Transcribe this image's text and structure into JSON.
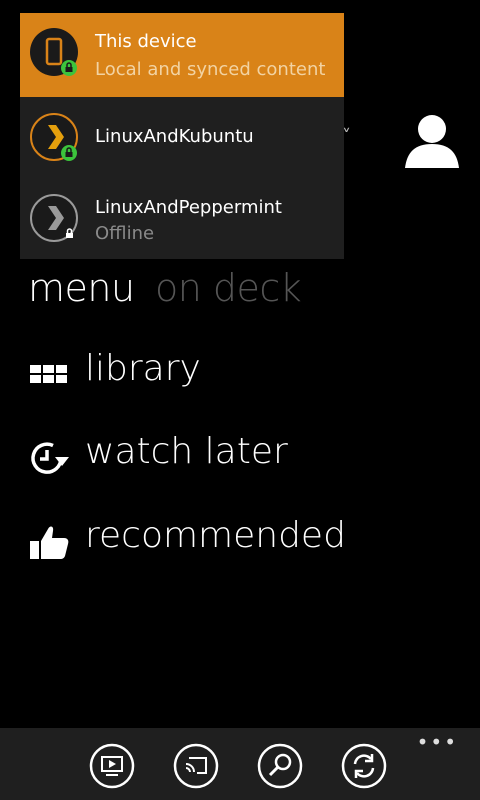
{
  "servers": [
    {
      "name": "This device",
      "subtitle": "Local and synced content",
      "icon": "phone-icon",
      "selected": true
    },
    {
      "name": "LinuxAndKubuntu",
      "subtitle": "",
      "icon": "plex-icon",
      "selected": false
    },
    {
      "name": "LinuxAndPeppermint",
      "subtitle": "Offline",
      "icon": "plex-icon",
      "selected": false
    }
  ],
  "pivots": {
    "active": "menu",
    "inactive": "on deck"
  },
  "menu": {
    "library": "library",
    "watch_later": "watch later",
    "recommended": "recommended"
  },
  "app_bar": {
    "more": "•••"
  },
  "header": {
    "chevron": "˅"
  },
  "colors": {
    "accent": "#d98318",
    "online": "#3cc43c",
    "background": "#000000",
    "panel": "#1f1f1f"
  }
}
